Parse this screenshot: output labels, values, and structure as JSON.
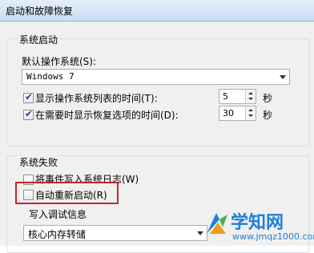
{
  "window": {
    "title": "启动和故障恢复"
  },
  "system_startup": {
    "group_title": "系统启动",
    "default_os_label": "默认操作系统(S):",
    "default_os_value": "Windows 7",
    "show_os_list_label": "显示操作系统列表的时间(T):",
    "show_os_list_checked": true,
    "show_os_list_value": "5",
    "show_os_list_unit": "秒",
    "show_recovery_label": "在需要时显示恢复选项的时间(D):",
    "show_recovery_checked": true,
    "show_recovery_value": "30",
    "show_recovery_unit": "秒"
  },
  "system_failure": {
    "group_title": "系统失败",
    "write_event_label": "将事件写入系统日志(W)",
    "write_event_checked": false,
    "auto_restart_label": "自动重新启动(R)",
    "auto_restart_checked": false,
    "debug_info_title": "写入调试信息",
    "debug_info_value": "核心内存转储"
  },
  "watermark": {
    "main_text": "学知网",
    "sub_text": "www.jmqz1000.com",
    "colors": {
      "blue": "#1f7fd6",
      "orange": "#f29a1e",
      "green": "#4caf50"
    }
  },
  "colors": {
    "highlight_border": "#c0272d",
    "check_mark": "#1c3f8c"
  }
}
